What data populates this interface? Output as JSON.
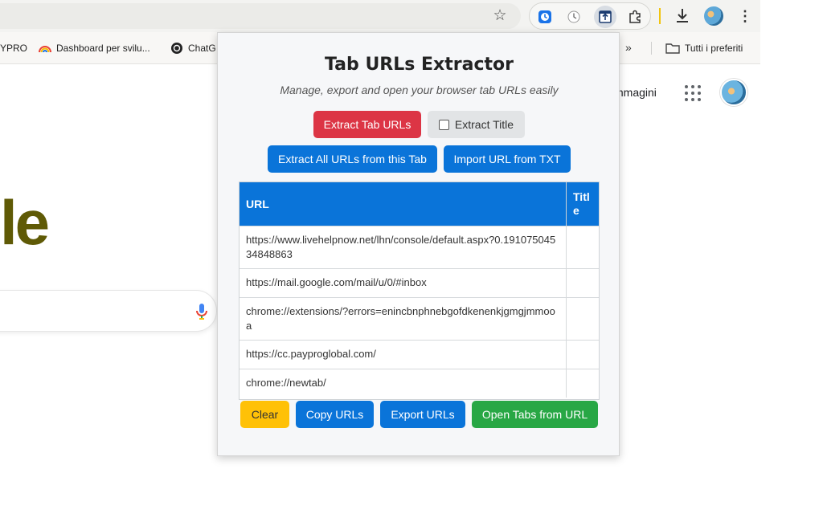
{
  "browser": {
    "bookmarks": [
      {
        "label": "YPRO"
      },
      {
        "label": "Dashboard per svilu..."
      },
      {
        "label": "ChatG"
      },
      {
        "label": "Tutti i preferiti"
      }
    ],
    "more_bookmarks": "»"
  },
  "page": {
    "logo_fragment": "le",
    "images_link": "mmagini"
  },
  "popup": {
    "title": "Tab URLs Extractor",
    "subtitle": "Manage, export and open your browser tab URLs easily",
    "buttons": {
      "extract_tab_urls": "Extract Tab URLs",
      "extract_title": "Extract Title",
      "extract_all_urls": "Extract All URLs from this Tab",
      "import_url": "Import URL from TXT",
      "clear": "Clear",
      "copy_urls": "Copy URLs",
      "export_urls": "Export URLs",
      "open_tabs": "Open Tabs from URL"
    },
    "table": {
      "headers": {
        "url": "URL",
        "title": "Title"
      },
      "rows": [
        {
          "url": "https://www.livehelpnow.net/lhn/console/default.aspx?0.19107504534848863",
          "title": ""
        },
        {
          "url": "https://mail.google.com/mail/u/0/#inbox",
          "title": ""
        },
        {
          "url": "chrome://extensions/?errors=enincbnphnebgofdkenenkjgmgjmmooa",
          "title": ""
        },
        {
          "url": "https://cc.payproglobal.com/",
          "title": ""
        },
        {
          "url": "chrome://newtab/",
          "title": ""
        }
      ]
    }
  },
  "colors": {
    "red": "#dc3545",
    "blue": "#0a74d9",
    "yellow": "#ffc107",
    "green": "#28a745"
  }
}
